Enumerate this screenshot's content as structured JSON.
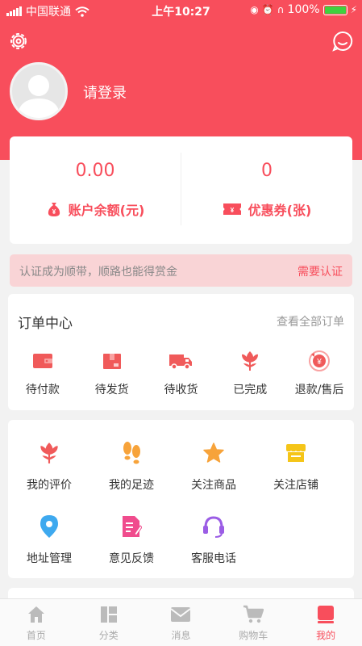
{
  "status_bar": {
    "carrier": "中国联通",
    "time": "上午10:27",
    "battery": "100%"
  },
  "profile": {
    "login_text": "请登录"
  },
  "balance": {
    "account_value": "0.00",
    "account_label": "账户余额(元)",
    "coupon_value": "0",
    "coupon_label": "优惠券(张)"
  },
  "verify_banner": {
    "text": "认证成为顺带，顺路也能得赏金",
    "action": "需要认证"
  },
  "orders": {
    "title": "订单中心",
    "view_all": "查看全部订单",
    "items": [
      {
        "label": "待付款",
        "icon": "wallet-icon"
      },
      {
        "label": "待发货",
        "icon": "box-icon"
      },
      {
        "label": "待收货",
        "icon": "truck-icon"
      },
      {
        "label": "已完成",
        "icon": "flower-icon"
      },
      {
        "label": "退款/售后",
        "icon": "refund-icon"
      }
    ]
  },
  "tools": {
    "items": [
      {
        "label": "我的评价",
        "icon": "flower-icon"
      },
      {
        "label": "我的足迹",
        "icon": "footprint-icon"
      },
      {
        "label": "关注商品",
        "icon": "star-icon"
      },
      {
        "label": "关注店铺",
        "icon": "shop-icon"
      },
      {
        "label": "地址管理",
        "icon": "location-icon"
      },
      {
        "label": "意见反馈",
        "icon": "feedback-icon"
      },
      {
        "label": "客服电话",
        "icon": "headset-icon"
      }
    ]
  },
  "tab_bar": {
    "items": [
      {
        "label": "首页",
        "icon": "home-icon"
      },
      {
        "label": "分类",
        "icon": "category-icon"
      },
      {
        "label": "消息",
        "icon": "message-icon"
      },
      {
        "label": "购物车",
        "icon": "cart-icon"
      },
      {
        "label": "我的",
        "icon": "profile-icon"
      }
    ],
    "active": "我的"
  },
  "colors": {
    "brand": "#f84e5c",
    "banner_bg": "#f9d4d6",
    "page_bg": "#f2f2f2"
  }
}
